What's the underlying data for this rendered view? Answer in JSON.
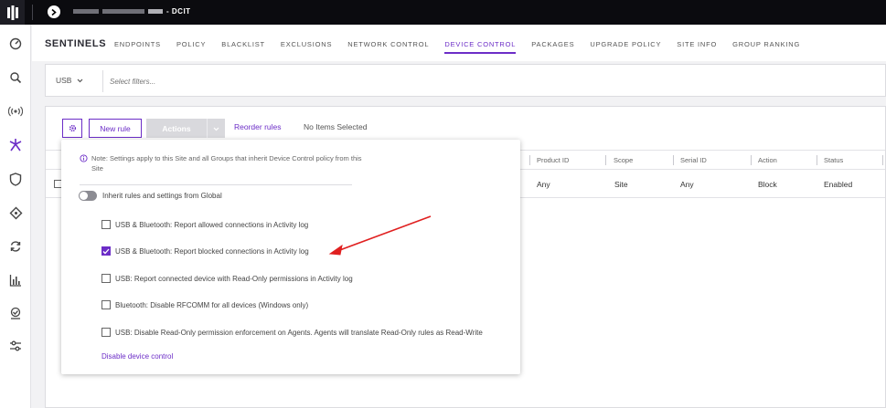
{
  "topbar": {
    "site_suffix": "- DCIT"
  },
  "header": {
    "brand": "SENTINELS",
    "tabs": [
      {
        "label": "ENDPOINTS"
      },
      {
        "label": "POLICY"
      },
      {
        "label": "BLACKLIST"
      },
      {
        "label": "EXCLUSIONS"
      },
      {
        "label": "NETWORK CONTROL"
      },
      {
        "label": "DEVICE CONTROL",
        "active": true
      },
      {
        "label": "PACKAGES"
      },
      {
        "label": "UPGRADE POLICY"
      },
      {
        "label": "SITE INFO"
      },
      {
        "label": "GROUP RANKING"
      }
    ]
  },
  "filters": {
    "interface": "USB",
    "placeholder": "Select filters..."
  },
  "toolbar": {
    "new_rule": "New rule",
    "actions": "Actions",
    "reorder": "Reorder rules",
    "selection_status": "No Items Selected"
  },
  "table": {
    "columns": [
      "Product ID",
      "Scope",
      "Serial ID",
      "Action",
      "Status"
    ],
    "rows": [
      {
        "product_id": "Any",
        "scope": "Site",
        "serial_id": "Any",
        "action": "Block",
        "status": "Enabled"
      }
    ]
  },
  "popover": {
    "note": "Note: Settings apply to this Site and all Groups that inherit Device Control policy from this Site",
    "inherit_label": "Inherit rules and settings from Global",
    "inherit_enabled": false,
    "options": [
      {
        "label": "USB & Bluetooth: Report allowed connections in Activity log",
        "checked": false
      },
      {
        "label": "USB & Bluetooth: Report blocked connections in Activity log",
        "checked": true
      },
      {
        "label": "USB: Report connected device with Read-Only permissions in Activity log",
        "checked": false
      },
      {
        "label": "Bluetooth: Disable RFCOMM for all devices (Windows only)",
        "checked": false
      },
      {
        "label": "USB: Disable Read-Only permission enforcement on Agents. Agents will translate Read-Only rules as Read-Write",
        "checked": false
      }
    ],
    "disable_link": "Disable device control"
  },
  "colors": {
    "accent": "#6c2dc7",
    "annotation_arrow": "#e02020"
  },
  "icons": {
    "nav": [
      "dashboard-icon",
      "search-icon",
      "broadcast-icon",
      "sentinels-icon",
      "shield-icon",
      "network-icon",
      "sync-icon",
      "reports-icon",
      "package-icon",
      "settings-sliders-icon"
    ]
  }
}
